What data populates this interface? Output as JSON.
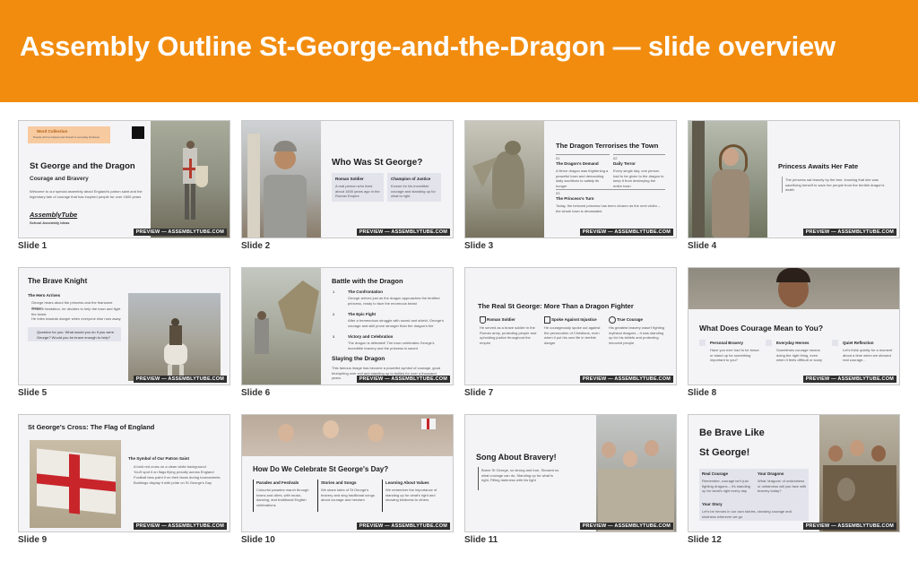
{
  "header": {
    "title": "Assembly Outline St-George-and-the-Dragon — slide overview"
  },
  "watermark": "PREVIEW — ASSEMBLYTUBE.COM",
  "colors": {
    "banner": "#f28c0f",
    "slide_bg": "#f4f4f6",
    "box_bg": "#e3e3ec"
  },
  "slides": [
    {
      "label": "Slide 1",
      "title": "St George and the Dragon",
      "subtitle": "Courage and Bravery",
      "intro": "Welcome to our special assembly about England's patron saint and the legendary tale of courage that has inspired people for over 1600 years",
      "tag_title": "Word Collection",
      "tag_text": "People who've helped and shared in everyday kindness",
      "logo": "AssemblyTube",
      "logo_sub": "School Assembly Ideas"
    },
    {
      "label": "Slide 2",
      "title": "Who Was St George?",
      "boxes": [
        {
          "title": "Roman Soldier",
          "text": "A real person who lived about 1600 years ago in the Roman Empire"
        },
        {
          "title": "Champion of Justice",
          "text": "Known for his incredible courage and standing up for what is right"
        }
      ]
    },
    {
      "label": "Slide 3",
      "title": "The Dragon Terrorises the Town",
      "items": [
        {
          "num": "01",
          "title": "The Dragon's Demand",
          "text": "A fierce dragon was frightening a peaceful town and demanding daily sacrifices to satisfy its hunger"
        },
        {
          "num": "02",
          "title": "Daily Terror",
          "text": "Every single day, one person had to be given to the dragon to keep it from destroying the entire town"
        },
        {
          "num": "03",
          "title": "The Princess's Turn",
          "text": "Today, the beloved princess has been chosen as the next victim – the whole town is devastated"
        }
      ]
    },
    {
      "label": "Slide 4",
      "title": "Princess Awaits Her Fate",
      "text": "The princess sat bravely by the tree, knowing that she was sacrificing herself to save her people from the terrible dragon's wrath."
    },
    {
      "label": "Slide 5",
      "title": "The Brave Knight",
      "section": "The Hero Arrives",
      "bullets": [
        "George hears about the princess and the fearsome dragon",
        "Without hesitation, he decides to help the town and fight the beast",
        "He rides towards danger when everyone else runs away"
      ],
      "question": "Question for you: What would you do if you were George? Would you be brave enough to help?"
    },
    {
      "label": "Slide 6",
      "title": "Battle with the Dragon",
      "steps": [
        {
          "num": "1",
          "title": "The Confrontation",
          "text": "George arrives just as the dragon approaches the terrified princess, ready to face the enormous beast"
        },
        {
          "num": "2",
          "title": "The Epic Fight",
          "text": "After a tremendous struggle with sword and shield, George's courage and skill prove stronger than the dragon's fire"
        },
        {
          "num": "3",
          "title": "Victory and Celebration",
          "text": "The dragon is defeated! The town celebrates George's incredible bravery and the princess is saved"
        }
      ],
      "subtitle": "Slaying the Dragon",
      "footer": "This famous image has become a powerful symbol of courage, good triumphing over evil and standing up to bullies for over a thousand years."
    },
    {
      "label": "Slide 7",
      "title": "The Real St George: More Than a Dragon Fighter",
      "columns": [
        {
          "title": "Roman Soldier",
          "text": "He served as a brave soldier in the Roman army, protecting people and upholding justice throughout the empire"
        },
        {
          "title": "Spoke Against Injustice",
          "text": "He courageously spoke out against the persecution of Christians, even when it put his own life in terrible danger"
        },
        {
          "title": "True Courage",
          "text": "His greatest bravery wasn't fighting mythical dragons – it was standing up for his beliefs and protecting innocent people"
        }
      ]
    },
    {
      "label": "Slide 8",
      "title": "What Does Courage Mean to You?",
      "columns": [
        {
          "title": "Personal Bravery",
          "text": "Have you ever had to be brave or stand up for something important to you?"
        },
        {
          "title": "Everyday Heroes",
          "text": "Sometimes courage means doing the right thing, even when it feels difficult or scary"
        },
        {
          "title": "Quiet Reflection",
          "text": "Let's think quietly for a moment about a time when we showed real courage..."
        }
      ]
    },
    {
      "label": "Slide 9",
      "title": "St George's Cross: The Flag of England",
      "section": "The Symbol of Our Patron Saint",
      "bullets": [
        "A bold red cross on a clean white background",
        "You'll spot it on flags flying proudly across England",
        "Football fans paint it on their faces during tournaments",
        "Buildings display it with pride on St George's Day"
      ]
    },
    {
      "label": "Slide 10",
      "title": "How Do We Celebrate St George's Day?",
      "columns": [
        {
          "title": "Parades and Festivals",
          "text": "Colourful parades march through towns and cities, with music, dancing, and traditional English celebrations"
        },
        {
          "title": "Stories and Songs",
          "text": "We share tales of St George's bravery and sing traditional songs about courage and heroism"
        },
        {
          "title": "Learning About Values",
          "text": "We remember the importance of standing up for what's right and showing kindness to others"
        }
      ]
    },
    {
      "label": "Slide 11",
      "title": "Song About Bravery!",
      "text": "Brave St George, so strong and true, Showed us what courage can do, Standing up for what is right, Filling darkness with his light"
    },
    {
      "label": "Slide 12",
      "title_line1": "Be Brave Like",
      "title_line2": "St George!",
      "boxes": [
        {
          "title": "Real Courage",
          "text": "Remember, courage isn't just fighting dragons – it's standing up for what's right every day"
        },
        {
          "title": "Your Dragons",
          "text": "What 'dragons' of unkindness or unfairness will you face with bravery today?"
        },
        {
          "title": "Your Story",
          "text": "Let's be heroes in our own stories, showing courage and kindness wherever we go"
        }
      ]
    }
  ]
}
